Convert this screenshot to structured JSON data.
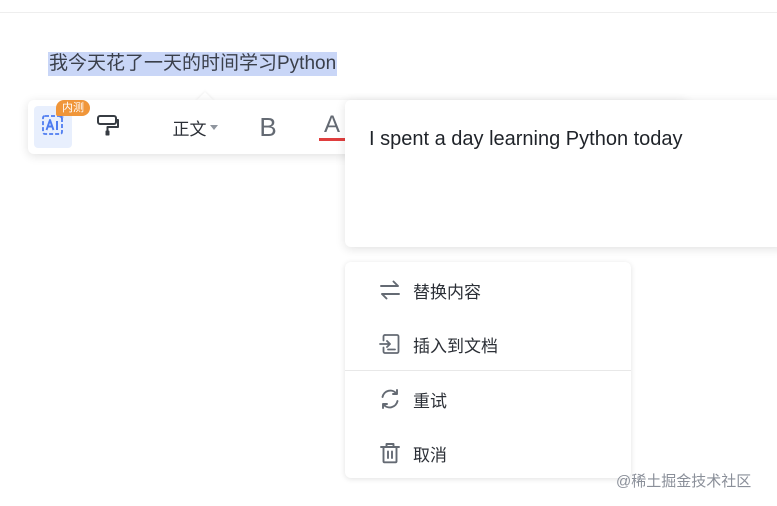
{
  "document": {
    "selected_text": "我今天花了一天的时间学习Python"
  },
  "toolbar": {
    "ai_icon": "ai-assistant-icon",
    "ai_badge": "内测",
    "brush_icon": "format-painter-icon",
    "style_label": "正文",
    "bold_label": "B",
    "font_color_label": "A",
    "font_color_hex": "#e03e3e"
  },
  "translation": {
    "text": "I spent a day learning Python today"
  },
  "menu": {
    "items": [
      {
        "icon": "swap-arrows-icon",
        "label": "替换内容"
      },
      {
        "icon": "insert-doc-icon",
        "label": "插入到文档"
      },
      {
        "icon": "refresh-icon",
        "label": "重试"
      },
      {
        "icon": "trash-icon",
        "label": "取消"
      }
    ]
  },
  "watermark": "@稀土掘金技术社区",
  "colors": {
    "accent": "#4e7cf0",
    "selection": "#c9d6f7",
    "badge": "#f0963a"
  }
}
